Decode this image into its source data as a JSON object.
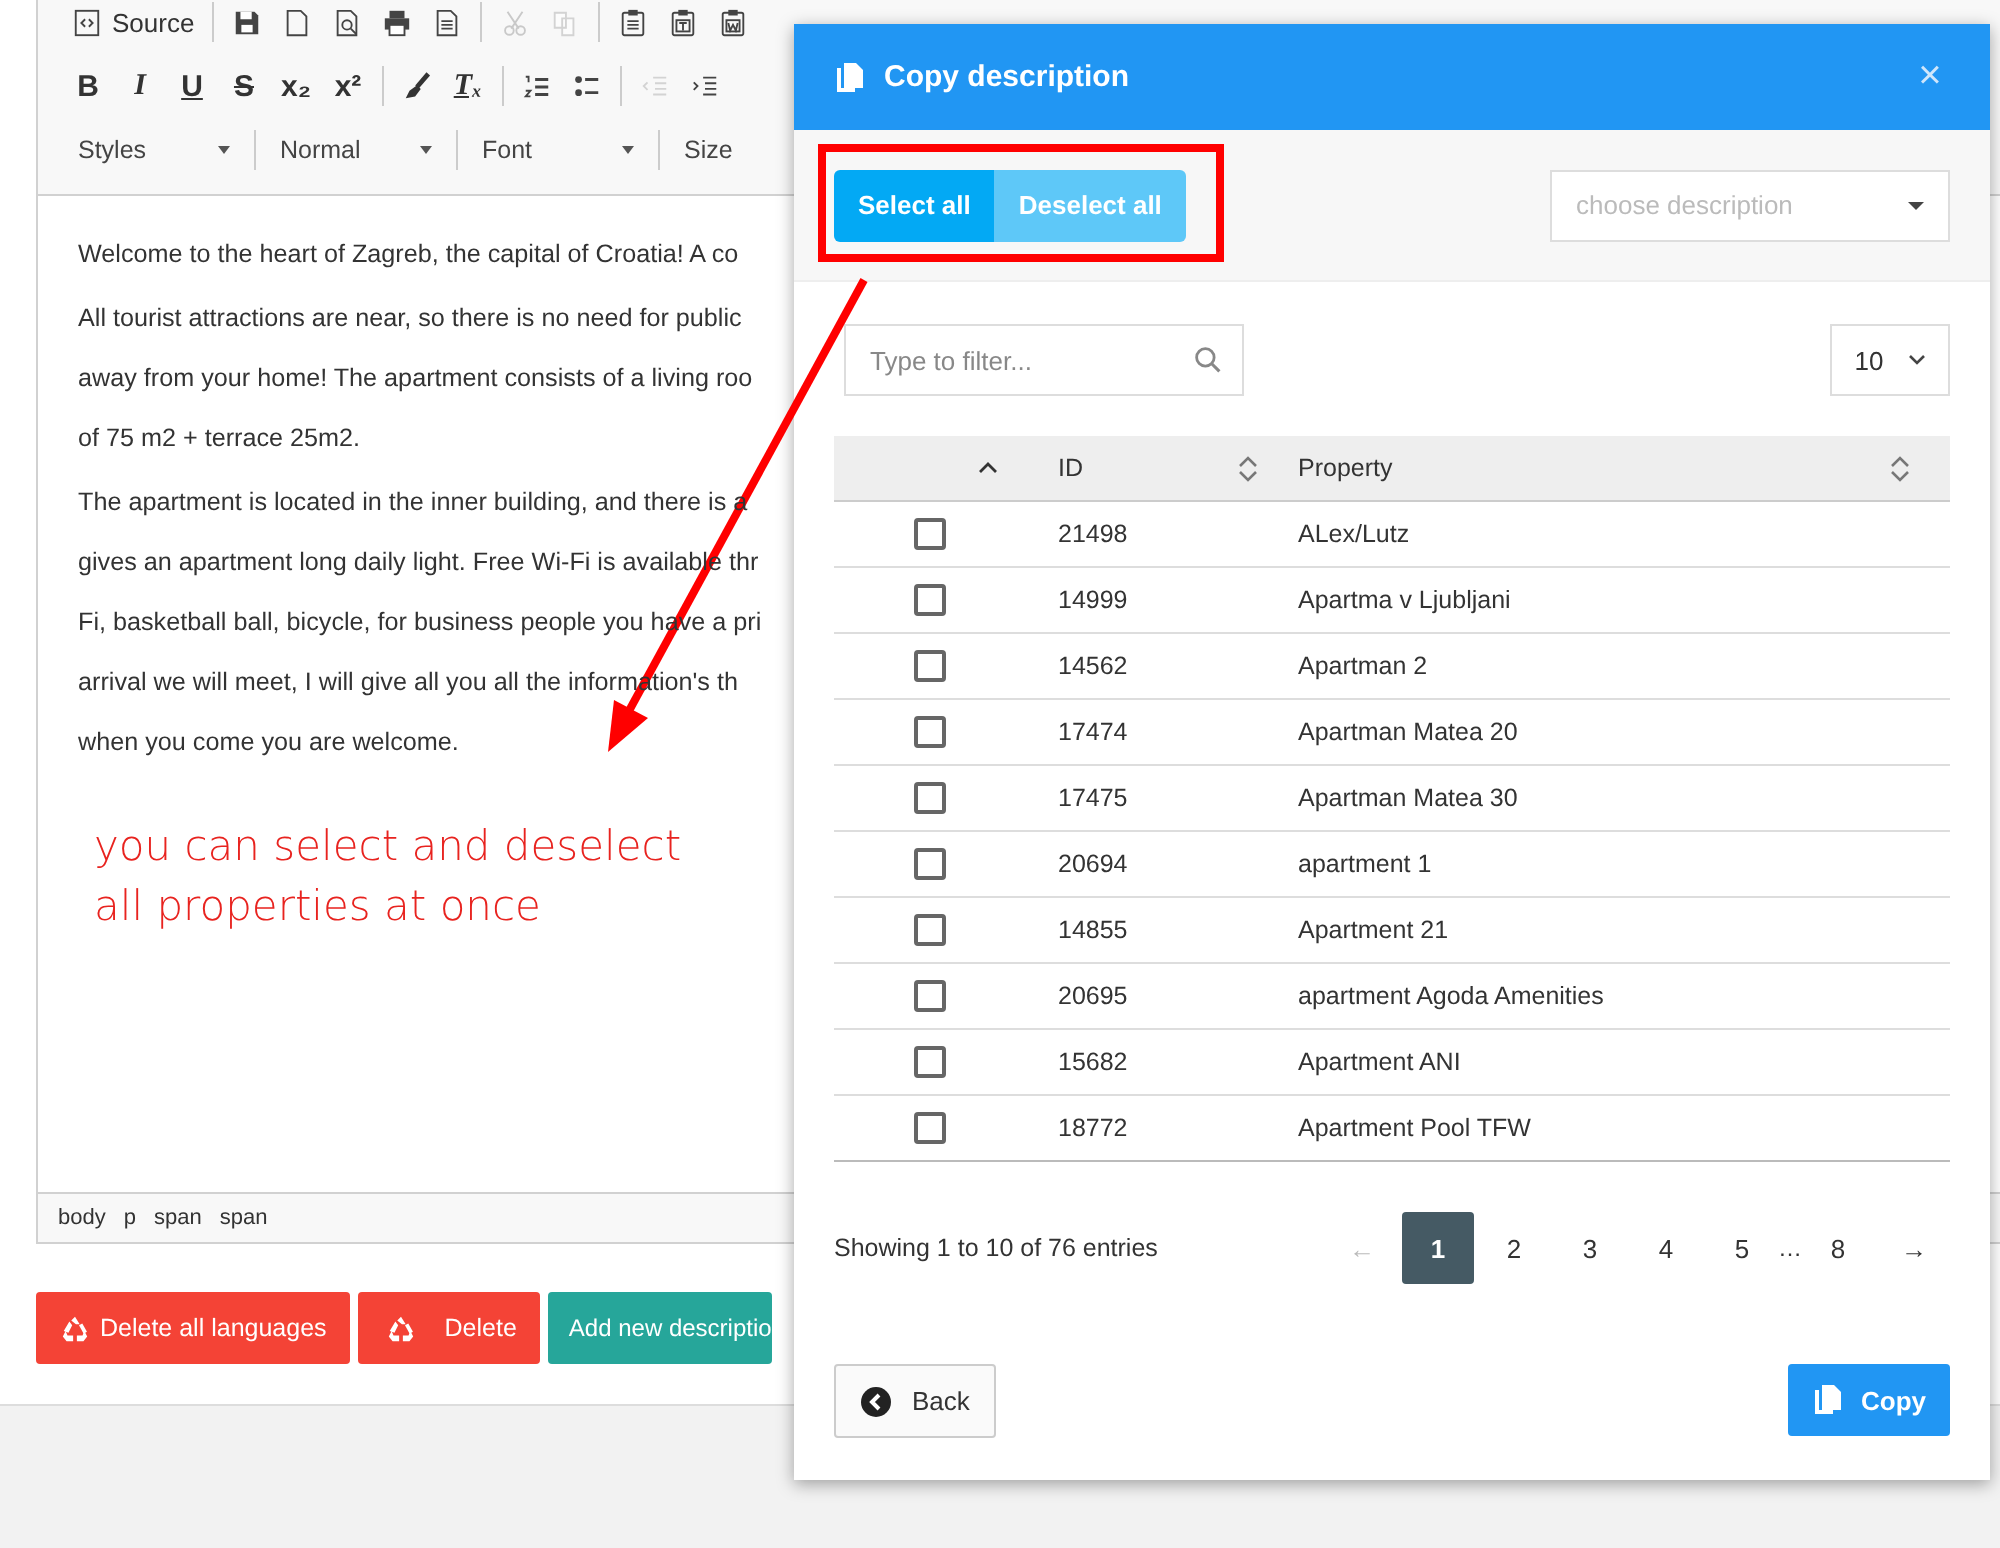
{
  "editor": {
    "toolbar": {
      "row_1": [
        {
          "kind": "icon-text",
          "label": "Source",
          "disabled": false
        },
        {
          "kind": "icon",
          "disabled": false
        },
        {
          "kind": "icon",
          "disabled": false
        },
        {
          "kind": "icon",
          "disabled": false
        },
        {
          "kind": "icon",
          "disabled": false
        },
        {
          "kind": "icon",
          "disabled": false
        },
        {
          "kind": "icon",
          "disabled": true
        },
        {
          "kind": "icon",
          "disabled": true
        },
        {
          "kind": "icon",
          "disabled": false
        },
        {
          "kind": "icon",
          "disabled": false
        },
        {
          "kind": "icon",
          "disabled": false
        }
      ],
      "row_2": [
        {
          "kind": "text",
          "label": "B",
          "disabled": false
        },
        {
          "kind": "text",
          "label": "I",
          "disabled": false
        },
        {
          "kind": "text",
          "label": "U",
          "disabled": false
        },
        {
          "kind": "text",
          "label": "S",
          "disabled": false
        },
        {
          "kind": "text",
          "label": "x₂",
          "disabled": false
        },
        {
          "kind": "text",
          "label": "x²",
          "disabled": false
        },
        {
          "kind": "icon",
          "disabled": false
        },
        {
          "kind": "text",
          "label": "Tₓ",
          "disabled": false
        },
        {
          "kind": "icon",
          "disabled": false
        },
        {
          "kind": "icon",
          "disabled": false
        },
        {
          "kind": "icon",
          "disabled": true
        },
        {
          "kind": "icon",
          "disabled": false
        }
      ],
      "dropdowns": [
        {
          "label": "Styles",
          "caret": true
        },
        {
          "label": "Normal",
          "caret": true
        },
        {
          "label": "Font",
          "caret": true
        },
        {
          "label": "Size",
          "caret": false
        }
      ]
    },
    "paragraphs": [
      [
        "Welcome to the heart of Zagreb, the capital of Croatia! A co"
      ],
      [
        "All tourist attractions are near, so there is no need for public",
        "away from your home! The apartment consists of a living roo",
        "of 75 m2 + terrace 25m2."
      ],
      [
        "The apartment is located in the inner building, and there is a",
        "gives an apartment long daily light. Free Wi-Fi is available thr",
        "Fi, basketball ball, bicycle, for business people you have a pri",
        "arrival we will meet, I will give all you all the information's th",
        "when you come you are welcome."
      ]
    ],
    "path": [
      "body",
      "p",
      "span",
      "span"
    ]
  },
  "actions": [
    {
      "label": "Delete all languages",
      "kind": "danger"
    },
    {
      "label": "Delete",
      "kind": "danger"
    },
    {
      "label": "Add new descriptio",
      "kind": "success"
    }
  ],
  "modal": {
    "title": "Copy description",
    "close": "×",
    "select_buttons": [
      {
        "label": "Select all",
        "kind": "strong"
      },
      {
        "label": "Deselect all",
        "kind": "light"
      }
    ],
    "description_select": {
      "placeholder": "choose description"
    },
    "filter": {
      "placeholder": "Type to filter..."
    },
    "page_size": "10",
    "columns": [
      {
        "sorted": true
      },
      {
        "label": "ID",
        "sorted": false
      },
      {
        "label": "Property",
        "sorted": false
      }
    ],
    "rows": [
      {
        "checked": false,
        "id": "21498",
        "property": "ALex/Lutz"
      },
      {
        "checked": false,
        "id": "14999",
        "property": "Apartma v Ljubljani"
      },
      {
        "checked": false,
        "id": "14562",
        "property": "Apartman 2"
      },
      {
        "checked": false,
        "id": "17474",
        "property": "Apartman Matea 20"
      },
      {
        "checked": false,
        "id": "17475",
        "property": "Apartman Matea 30"
      },
      {
        "checked": false,
        "id": "20694",
        "property": "apartment 1"
      },
      {
        "checked": false,
        "id": "14855",
        "property": "Apartment 21"
      },
      {
        "checked": false,
        "id": "20695",
        "property": "apartment Agoda Amenities"
      },
      {
        "checked": false,
        "id": "15682",
        "property": "Apartment ANI"
      },
      {
        "checked": false,
        "id": "18772",
        "property": "Apartment Pool TFW"
      }
    ],
    "info": "Showing 1 to 10 of 76 entries",
    "pagination": [
      {
        "kind": "arrow",
        "label": "←",
        "disabled": true,
        "selected": false
      },
      {
        "kind": "page",
        "label": "1",
        "selected": true
      },
      {
        "kind": "page",
        "label": "2",
        "selected": false
      },
      {
        "kind": "page",
        "label": "3",
        "selected": false
      },
      {
        "kind": "page",
        "label": "4",
        "selected": false
      },
      {
        "kind": "page",
        "label": "5",
        "selected": false
      },
      {
        "kind": "ellipsis",
        "label": "…"
      },
      {
        "kind": "page",
        "label": "8",
        "selected": false
      },
      {
        "kind": "arrow",
        "label": "→",
        "disabled": false,
        "selected": false
      }
    ],
    "back": "Back",
    "copy": "Copy"
  },
  "annotation": {
    "text": "you can select and deselect all properties at once"
  }
}
